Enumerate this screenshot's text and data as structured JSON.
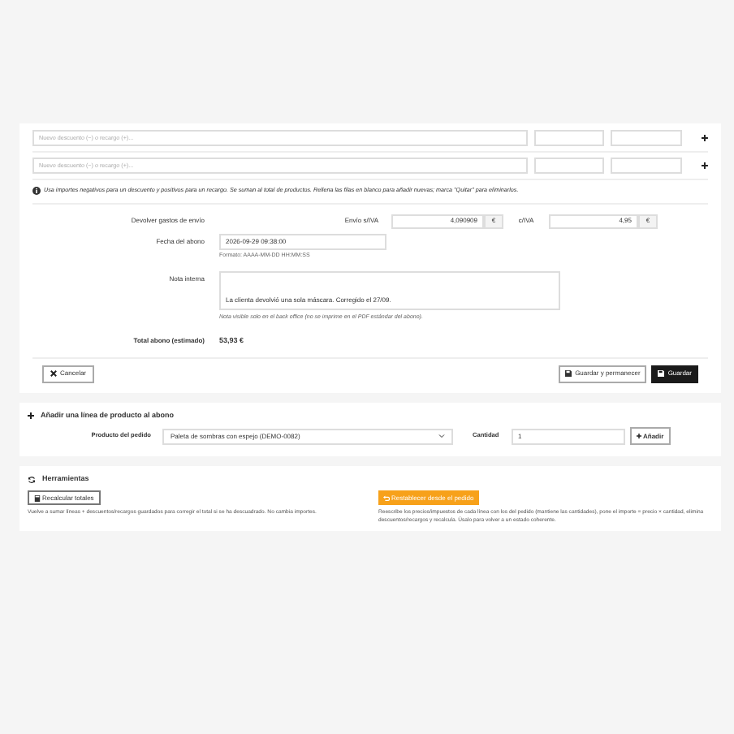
{
  "discounts": {
    "rows": [
      {
        "placeholder": "Nuevo descuento (−) o recargo (+)..."
      },
      {
        "placeholder": "Nuevo descuento (−) o recargo (+)..."
      }
    ],
    "info": "Usa importes negativos para un descuento y positivos para un recargo. Se suman al total de productos. Rellena las filas en blanco para añadir nuevas; marca \"Quitar\" para eliminarlos."
  },
  "shipping": {
    "label": "Devolver gastos de envío",
    "net_label": "Envío s/IVA",
    "net_value": "4,090909",
    "net_unit": "€",
    "gross_label": "c/IVA",
    "gross_value": "4,95",
    "gross_unit": "€"
  },
  "date": {
    "label": "Fecha del abono",
    "value": "2026-09-29 09:38:00",
    "hint": "Formato: AAAA-MM-DD HH:MM:SS"
  },
  "note": {
    "label": "Nota interna",
    "value": "La clienta devolvió una sola máscara. Corregido el 27/09.",
    "hint": "Nota visible solo en el back office (no se imprime en el PDF estándar del abono)."
  },
  "total": {
    "label": "Total abono (estimado)",
    "value": "53,93 €"
  },
  "actions": {
    "cancel": "Cancelar",
    "save_stay": "Guardar y permanecer",
    "save": "Guardar"
  },
  "add_line": {
    "title": "Añadir una línea de producto al abono",
    "product_label": "Producto del pedido",
    "product_value": "Paleta de sombras con espejo (DEMO-0082)",
    "qty_label": "Cantidad",
    "qty_value": "1",
    "button": "Añadir"
  },
  "tools": {
    "title": "Herramientas",
    "recalc_button": "Recalcular totales",
    "recalc_hint": "Vuelve a sumar líneas + descuentos/recargos guardados para corregir el total si se ha descuadrado. No cambia importes.",
    "reset_button": "Restablecer desde el pedido",
    "reset_hint": "Reescribe los precios/impuestos de cada línea con los del pedido (mantiene las cantidades), pone el importe = precio × cantidad, elimina descuentos/recargos y recalcula. Úsalo para volver a un estado coherente."
  }
}
